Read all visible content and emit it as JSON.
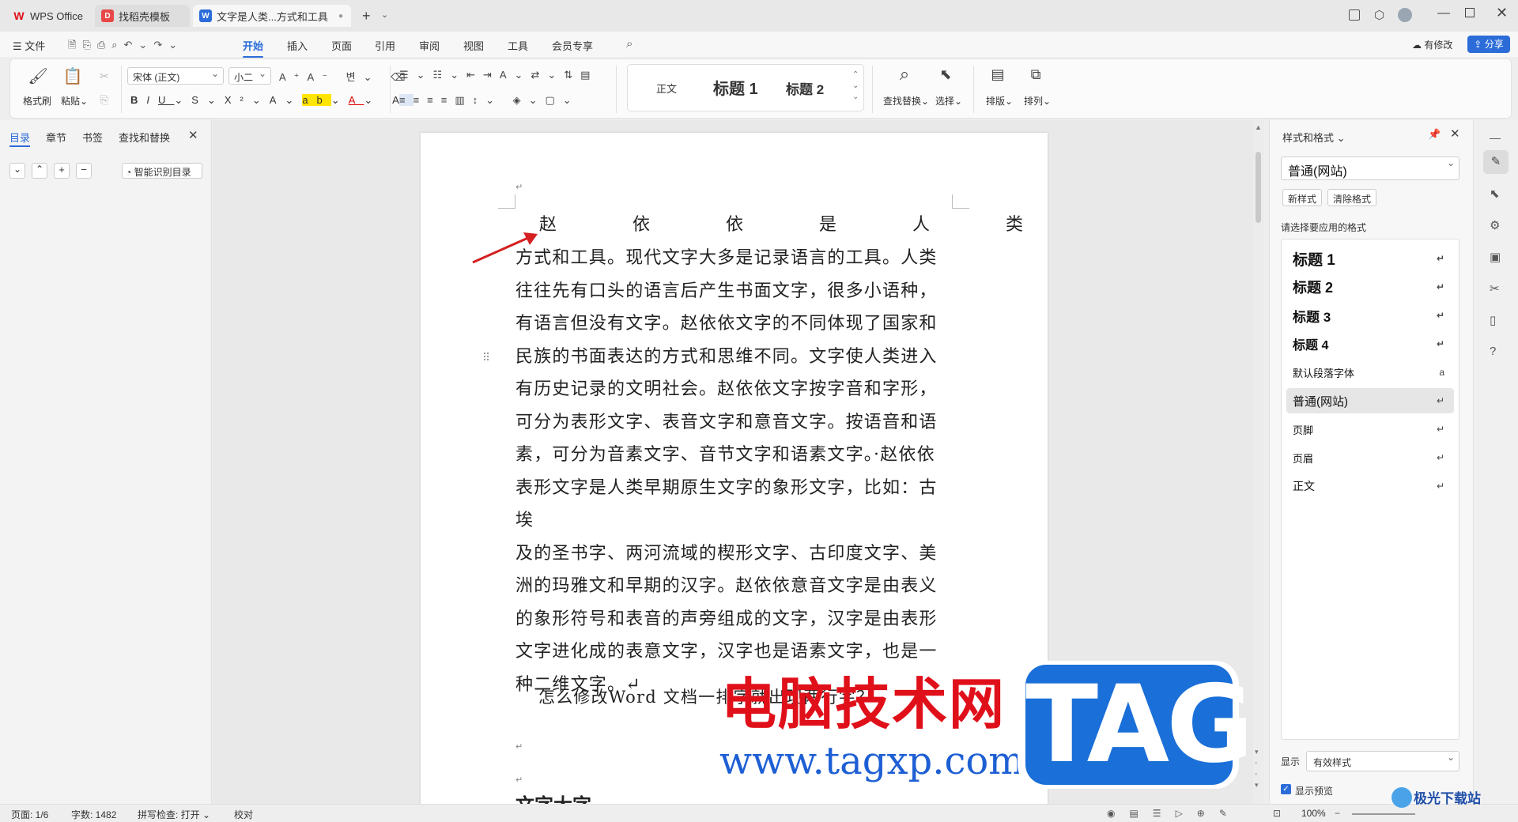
{
  "titlebar": {
    "tabs": [
      {
        "label": "WPS Office"
      },
      {
        "label": "找稻壳模板"
      },
      {
        "label": "文字是人类...方式和工具"
      }
    ],
    "new_tab_icon": "plus-icon"
  },
  "menubar": {
    "file": "文件",
    "items": [
      "开始",
      "插入",
      "页面",
      "引用",
      "审阅",
      "视图",
      "工具",
      "会员专享"
    ],
    "active": "开始",
    "modified": "有修改",
    "share": "分享"
  },
  "ribbon": {
    "format_painter": "格式刷",
    "paste": "粘贴",
    "font_name": "宋体 (正文)",
    "font_size": "小二",
    "styles": [
      "正文",
      "标题 1",
      "标题 2"
    ],
    "find_replace": "查找替换",
    "select": "选择",
    "arrange": "排版",
    "sort": "排列"
  },
  "leftpane": {
    "tabs": [
      "目录",
      "章节",
      "书签",
      "查找和替换"
    ],
    "active_tab": "目录",
    "smart_toc": "智能识别目录"
  },
  "document": {
    "first_line": [
      "赵",
      "依",
      "依",
      "是",
      "人",
      "类"
    ],
    "lines": [
      "方式和工具。现代文字大多是记录语言的工具。人类",
      "往往先有口头的语言后产生书面文字，很多小语种，",
      "有语言但没有文字。赵依依文字的不同体现了国家和",
      "民族的书面表达的方式和思维不同。文字使人类进入",
      "有历史记录的文明社会。赵依依文字按字音和字形，",
      "可分为表形文字、表音文字和意音文字。按语音和语",
      "素，可分为音素文字、音节文字和语素文字。·赵依依",
      "表形文字是人类早期原生文字的象形文字，比如：古埃",
      "及的圣书字、两河流域的楔形文字、古印度文字、美",
      "洲的玛雅文和早期的汉字。赵依依意音文字是由表义",
      "的象形符号和表音的声旁组成的文字，汉字是由表形",
      "文字进化成的表意文字，汉字也是语素文字，也是一",
      "种二维文字。↵"
    ],
    "line2": "怎么修改Word 文档一排字就出现两行字？",
    "heading_partial": "文字大字"
  },
  "rightpanel": {
    "title": "样式和格式",
    "current_style": "普通(网站)",
    "new_style": "新样式",
    "clear_format": "清除格式",
    "prompt": "请选择要应用的格式",
    "styles": [
      {
        "label": "标题  1",
        "kind": "h"
      },
      {
        "label": "标题  2",
        "kind": "h"
      },
      {
        "label": "标题  3",
        "kind": "h"
      },
      {
        "label": "标题  4",
        "kind": "h"
      },
      {
        "label": "默认段落字体",
        "kind": "p"
      },
      {
        "label": "普通(网站)",
        "kind": "sel"
      },
      {
        "label": "页脚",
        "kind": "p"
      },
      {
        "label": "页眉",
        "kind": "p"
      },
      {
        "label": "正文",
        "kind": "p"
      }
    ],
    "show_label": "显示",
    "show_value": "有效样式",
    "preview_label": "显示预览"
  },
  "statusbar": {
    "page": "页面: 1/6",
    "words": "字数: 1482",
    "spell": "拼写检查: 打开",
    "proof": "校对",
    "zoom": "100%"
  },
  "watermark": {
    "title": "电脑技术网",
    "url": "www.tagxp.com",
    "logo": "TAG",
    "corner": "极光下载站"
  },
  "colors": {
    "accent": "#2b6cd9",
    "watermark_red": "#e0101a",
    "watermark_blue": "#1e5fd4",
    "arrow_red": "#d42020"
  }
}
